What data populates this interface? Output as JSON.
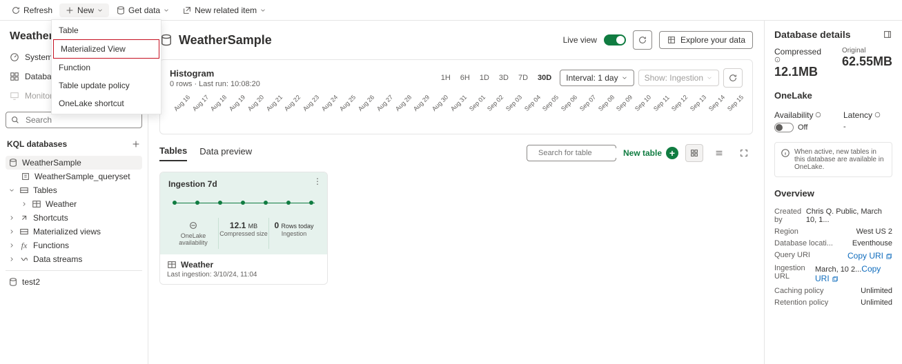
{
  "toolbar": {
    "refresh": "Refresh",
    "new": "New",
    "get_data": "Get data",
    "new_related": "New related item",
    "menu": [
      "Table",
      "Materialized View",
      "Function",
      "Table update policy",
      "OneLake shortcut"
    ]
  },
  "sidebar": {
    "title": "WeatherSample",
    "nav": [
      "System overview",
      "Databases",
      "Monitoring"
    ],
    "search_ph": "Search",
    "section": "KQL databases",
    "tree": {
      "db": "WeatherSample",
      "queryset": "WeatherSample_queryset",
      "groups": [
        "Tables",
        "Shortcuts",
        "Materialized views",
        "Functions",
        "Data streams"
      ],
      "weather": "Weather",
      "test": "test2"
    }
  },
  "main": {
    "title": "WeatherSample",
    "live_view": "Live view",
    "explore": "Explore your data",
    "hist": {
      "title": "Histogram",
      "sub": "0 rows · Last run: 10:08:20",
      "ranges": [
        "1H",
        "6H",
        "1D",
        "3D",
        "7D",
        "30D"
      ],
      "range_sel": "30D",
      "interval": "Interval: 1 day",
      "show": "Show: Ingestion",
      "dates": [
        "Aug 16",
        "Aug 17",
        "Aug 18",
        "Aug 19",
        "Aug 20",
        "Aug 21",
        "Aug 22",
        "Aug 23",
        "Aug 24",
        "Aug 25",
        "Aug 26",
        "Aug 27",
        "Aug 28",
        "Aug 29",
        "Aug 30",
        "Aug 31",
        "Sep 01",
        "Sep 02",
        "Sep 03",
        "Sep 04",
        "Sep 05",
        "Sep 06",
        "Sep 07",
        "Sep 08",
        "Sep 09",
        "Sep 10",
        "Sep 11",
        "Sep 12",
        "Sep 13",
        "Sep 14",
        "Sep 15"
      ]
    },
    "tabs": [
      "Tables",
      "Data preview"
    ],
    "search_table_ph": "Search for table",
    "new_table": "New table",
    "ingestion": {
      "title": "Ingestion 7d",
      "avail_label": "OneLake availability",
      "size": "12.1",
      "size_unit": "MB",
      "size_label": "Compressed size",
      "rows": "0",
      "rows_unit": "Rows today",
      "rows_label": "Ingestion",
      "table": "Weather",
      "last": "Last ingestion: 3/10/24, 11:04"
    }
  },
  "right": {
    "title": "Database details",
    "compressed_lbl": "Compressed",
    "compressed": "12.1MB",
    "original_lbl": "Original",
    "original": "62.55MB",
    "onelake": "OneLake",
    "availability": "Availability",
    "off": "Off",
    "latency": "Latency",
    "latency_v": "-",
    "info": "When active, new tables in this database are available in OneLake.",
    "overview": "Overview",
    "rows": [
      {
        "k": "Created by",
        "v": "Chris Q. Public, March 10, 1..."
      },
      {
        "k": "Region",
        "v": "West US 2"
      },
      {
        "k": "Database locati...",
        "v": "Eventhouse"
      },
      {
        "k": "Query URI",
        "v": "Copy URI",
        "link": true,
        "copy": true
      },
      {
        "k": "Ingestion URL",
        "v": "March, 10 2...",
        "extra": "Copy URI",
        "copy": true
      },
      {
        "k": "Caching policy",
        "v": "Unlimited"
      },
      {
        "k": "Retention policy",
        "v": "Unlimited"
      }
    ]
  },
  "chart_data": {
    "type": "bar",
    "categories": [
      "Aug 16",
      "Aug 17",
      "Aug 18",
      "Aug 19",
      "Aug 20",
      "Aug 21",
      "Aug 22",
      "Aug 23",
      "Aug 24",
      "Aug 25",
      "Aug 26",
      "Aug 27",
      "Aug 28",
      "Aug 29",
      "Aug 30",
      "Aug 31",
      "Sep 01",
      "Sep 02",
      "Sep 03",
      "Sep 04",
      "Sep 05",
      "Sep 06",
      "Sep 07",
      "Sep 08",
      "Sep 09",
      "Sep 10",
      "Sep 11",
      "Sep 12",
      "Sep 13",
      "Sep 14",
      "Sep 15"
    ],
    "values": [
      0,
      0,
      0,
      0,
      0,
      0,
      0,
      0,
      0,
      0,
      0,
      0,
      0,
      0,
      0,
      0,
      0,
      0,
      0,
      0,
      0,
      0,
      0,
      0,
      0,
      0,
      0,
      0,
      0,
      0,
      0
    ],
    "title": "Histogram",
    "xlabel": "",
    "ylabel": "",
    "ylim": [
      0,
      0
    ]
  }
}
